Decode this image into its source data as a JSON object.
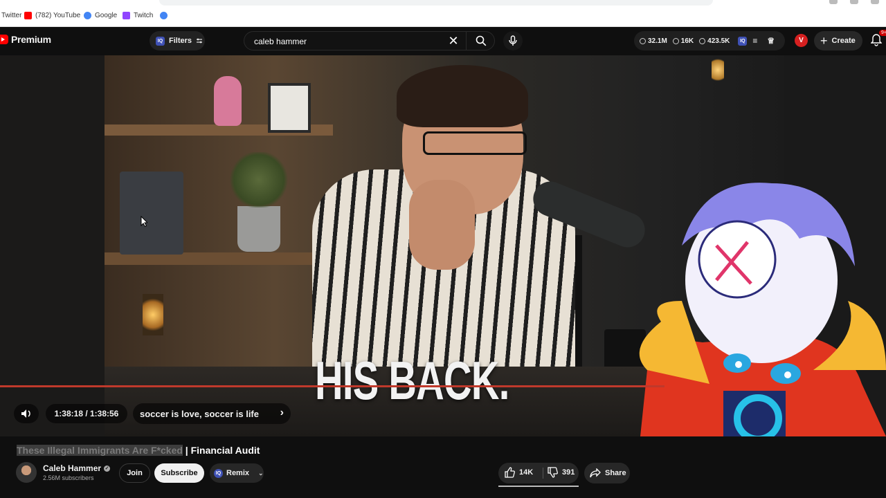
{
  "bookmarks": [
    {
      "label": "Twitter",
      "icon": "twitter-icon",
      "color": "#1d9bf0"
    },
    {
      "label": "(782) YouTube",
      "icon": "youtube-icon",
      "color": "#ff0000"
    },
    {
      "label": "Google",
      "icon": "google-icon",
      "color": "#4285f4"
    },
    {
      "label": "Twitch",
      "icon": "twitch-icon",
      "color": "#9146ff"
    },
    {
      "label": "",
      "icon": "google-icon",
      "color": "#4285f4"
    }
  ],
  "header": {
    "logo_text": "Premium",
    "filters_label": "Filters",
    "search_value": "caleb hammer",
    "stats": [
      "32.1M",
      "16K",
      "423.5K"
    ],
    "avatar_letter": "V",
    "create_label": "Create",
    "notifications": "9+"
  },
  "player": {
    "caption": "HIS BACK.",
    "time": "1:38:18 / 1:38:56",
    "chapter": "soccer is love, soccer is life",
    "progress": 0.9996
  },
  "video": {
    "title_highlight": "These Illegal Immigrants Are F*cked",
    "title_rest": " | Financial Audit",
    "channel": "Caleb Hammer",
    "subscribers": "2.56M subscribers",
    "join_label": "Join",
    "subscribe_label": "Subscribe",
    "remix_label": "Remix",
    "likes": "14K",
    "dislikes": "391",
    "share_label": "Share"
  },
  "colors": {
    "accent": "#ff0000",
    "progress": "#c0392b",
    "background": "#0f0f0f"
  }
}
